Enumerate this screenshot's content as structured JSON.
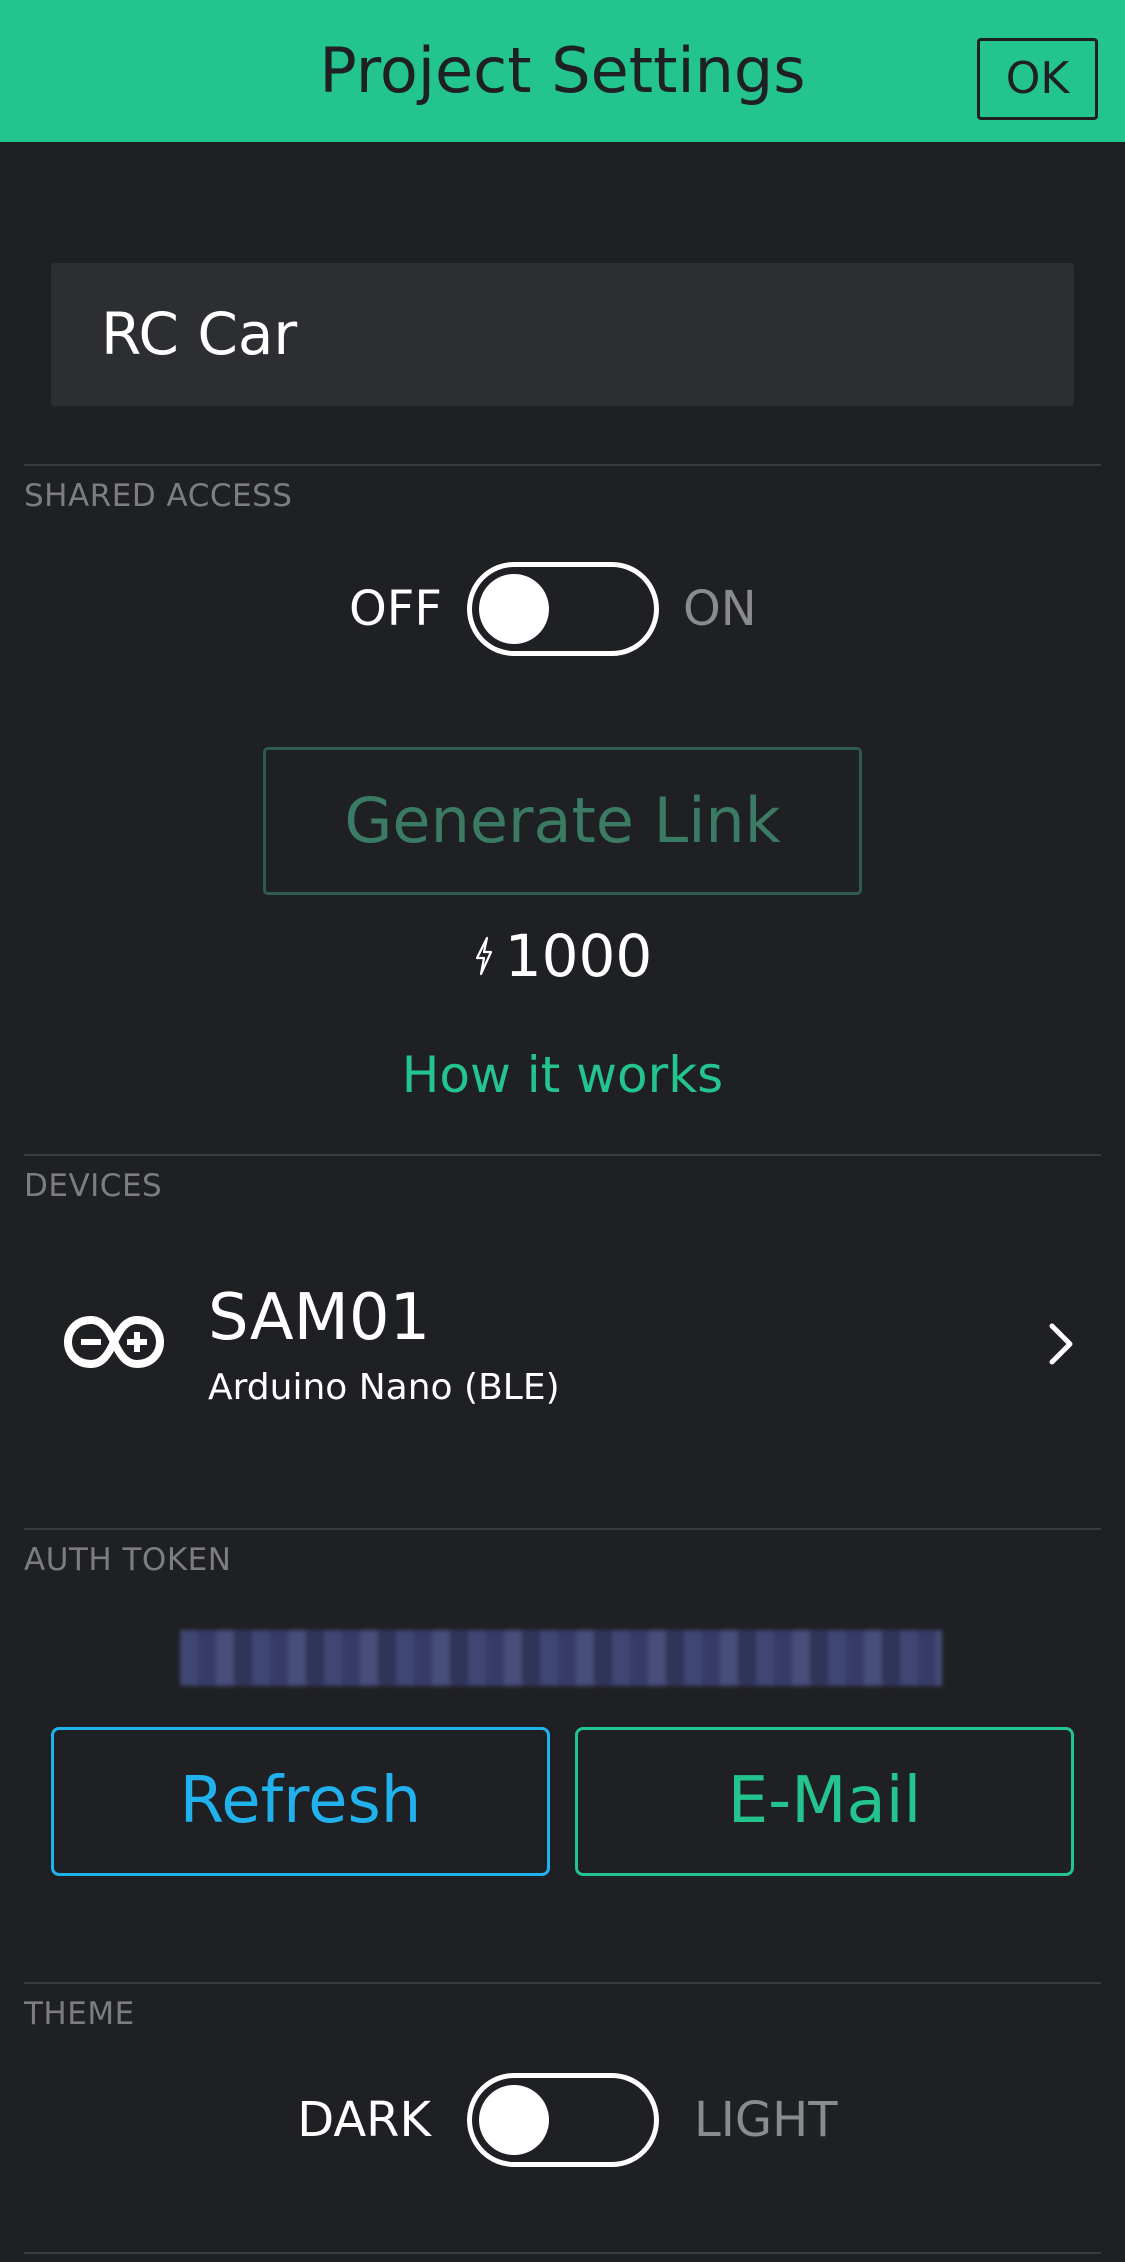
{
  "header": {
    "title": "Project Settings",
    "ok_label": "OK"
  },
  "project": {
    "name": "RC Car"
  },
  "shared_access": {
    "section_label": "SHARED ACCESS",
    "off_label": "OFF",
    "on_label": "ON",
    "enabled": false,
    "generate_link_label": "Generate Link",
    "energy_cost": "1000",
    "how_it_works_label": "How it works"
  },
  "devices": {
    "section_label": "DEVICES",
    "items": [
      {
        "name": "SAM01",
        "model": "Arduino Nano (BLE)",
        "icon": "arduino-icon"
      }
    ]
  },
  "auth_token": {
    "section_label": "AUTH TOKEN",
    "refresh_label": "Refresh",
    "email_label": "E-Mail"
  },
  "theme": {
    "section_label": "THEME",
    "dark_label": "DARK",
    "light_label": "LIGHT",
    "light_enabled": false
  },
  "colors": {
    "accent": "#23c48e",
    "background": "#1f2023",
    "refresh_blue": "#21b2ee"
  }
}
